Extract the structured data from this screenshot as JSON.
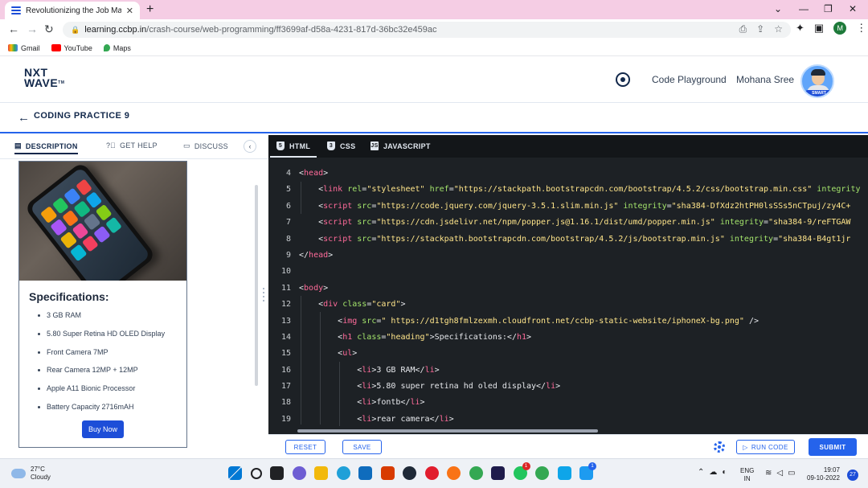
{
  "browser": {
    "tab_title": "Revolutionizing the Job Market |",
    "url_host": "learning.ccbp.in",
    "url_path": "/crash-course/web-programming/ff3699af-d58a-4231-817d-36bc32e459ac",
    "profile_initial": "M",
    "bookmarks": [
      "Gmail",
      "YouTube",
      "Maps"
    ]
  },
  "header": {
    "logo_line1": "NXT",
    "logo_line2": "WAVE",
    "logo_tm": "TM",
    "code_playground": "Code Playground",
    "user_name": "Mohana Sree",
    "avatar_badge": "SMART"
  },
  "practice": {
    "title": "CODING PRACTICE 9"
  },
  "left_tabs": {
    "description": "DESCRIPTION",
    "get_help": "GET HELP",
    "discuss": "DISCUSS"
  },
  "card": {
    "heading": "Specifications:",
    "specs": [
      "3 GB RAM",
      "5.80 Super Retina HD OLED Display",
      "Front Camera 7MP",
      "Rear Camera 12MP + 12MP",
      "Apple A11 Bionic Processor",
      "Battery Capacity 2716mAH"
    ],
    "buy_label": "Buy Now"
  },
  "editor": {
    "tabs": [
      "HTML",
      "CSS",
      "JAVASCRIPT"
    ],
    "line_numbers": [
      "4",
      "5",
      "6",
      "7",
      "8",
      "9",
      "10",
      "11",
      "12",
      "13",
      "14",
      "15",
      "16",
      "17",
      "18",
      "19"
    ]
  },
  "actions": {
    "reset": "RESET",
    "save": "SAVE",
    "run_code": "RUN CODE",
    "submit": "SUBMIT"
  },
  "taskbar": {
    "temp": "27°C",
    "weather": "Cloudy",
    "lang1": "ENG",
    "lang2": "IN",
    "time": "19:07",
    "date": "09-10-2022",
    "notifications": "27",
    "badge_whatsapp": "1",
    "badge_twitter": "1"
  }
}
